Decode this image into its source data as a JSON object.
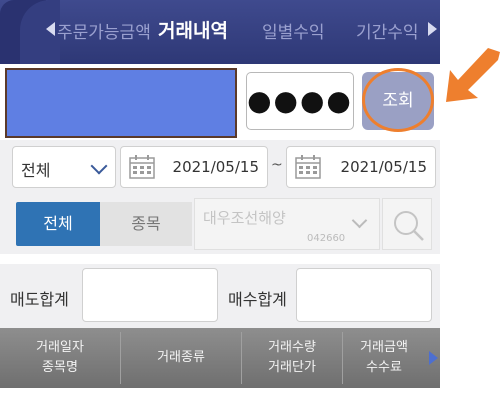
{
  "tabs": {
    "prev": "주문가능금액",
    "active": "거래내역",
    "next1": "일별수익",
    "next2": "기간수익"
  },
  "account": {
    "password_masked": "●●●●",
    "query_label": "조회"
  },
  "filter": {
    "type_select": "전체",
    "date_from": "2021/05/15",
    "date_sep": "~",
    "date_to": "2021/05/15"
  },
  "segment": {
    "all_label": "전체",
    "item_label": "종목",
    "stock_name": "대우조선해양",
    "stock_code": "042660"
  },
  "summary": {
    "sell_total_label": "매도합계",
    "buy_total_label": "매수합계"
  },
  "table_header": {
    "col1_line1": "거래일자",
    "col1_line2": "종목명",
    "col2": "거래종류",
    "col3_line1": "거래수량",
    "col3_line2": "거래단가",
    "col4_line1": "거래금액",
    "col4_line2": "수수료"
  },
  "colors": {
    "tab_bg": "#2e3876",
    "account_fill": "#5f7fe3",
    "highlight": "#ee7f2e",
    "segment_active": "#2f73b4"
  }
}
